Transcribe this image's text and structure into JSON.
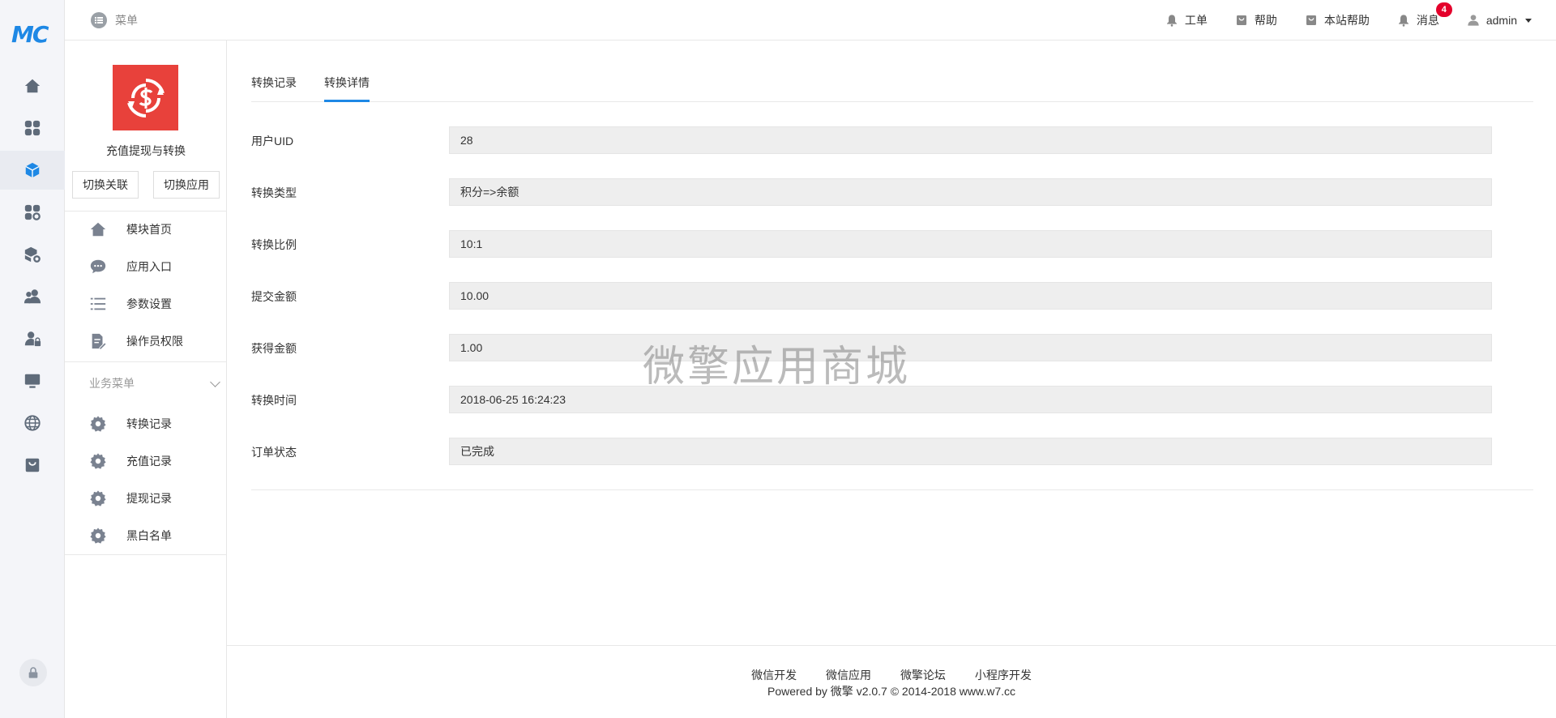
{
  "brand": {
    "logo_text": "MC"
  },
  "header": {
    "menu_label": "菜单",
    "nav": [
      {
        "label": "工单",
        "icon": "bell-icon"
      },
      {
        "label": "帮助",
        "icon": "bag-icon"
      },
      {
        "label": "本站帮助",
        "icon": "bag-icon"
      },
      {
        "label": "消息",
        "icon": "bell-icon",
        "badge": "4"
      }
    ],
    "user": "admin"
  },
  "sidebar": {
    "app_name": "充值提现与转换",
    "buttons": {
      "switch_link": "切换关联",
      "switch_app": "切换应用"
    },
    "items": [
      {
        "label": "模块首页",
        "icon": "home-icon"
      },
      {
        "label": "应用入口",
        "icon": "chat-icon"
      },
      {
        "label": "参数设置",
        "icon": "list-icon"
      },
      {
        "label": "操作员权限",
        "icon": "document-edit-icon"
      }
    ],
    "group_title": "业务菜单",
    "business": [
      {
        "label": "转换记录",
        "icon": "gear-icon"
      },
      {
        "label": "充值记录",
        "icon": "gear-icon"
      },
      {
        "label": "提现记录",
        "icon": "gear-icon"
      },
      {
        "label": "黑白名单",
        "icon": "gear-icon"
      }
    ]
  },
  "tabs": [
    {
      "label": "转换记录",
      "active": false
    },
    {
      "label": "转换详情",
      "active": true
    }
  ],
  "fields": [
    {
      "label": "用户UID",
      "value": "28"
    },
    {
      "label": "转换类型",
      "value": "积分=>余额"
    },
    {
      "label": "转换比例",
      "value": "10:1"
    },
    {
      "label": "提交金额",
      "value": "10.00"
    },
    {
      "label": "获得金额",
      "value": "1.00"
    },
    {
      "label": "转换时间",
      "value": "2018-06-25 16:24:23"
    },
    {
      "label": "订单状态",
      "value": "已完成"
    }
  ],
  "watermark": "微擎应用商城",
  "footer": {
    "links": [
      "微信开发",
      "微信应用",
      "微擎论坛",
      "小程序开发"
    ],
    "copyright": "Powered by 微擎 v2.0.7 © 2014-2018 www.w7.cc"
  },
  "colors": {
    "accent": "#1e88e5",
    "app_logo": "#e8413b",
    "badge": "#e4002b"
  }
}
